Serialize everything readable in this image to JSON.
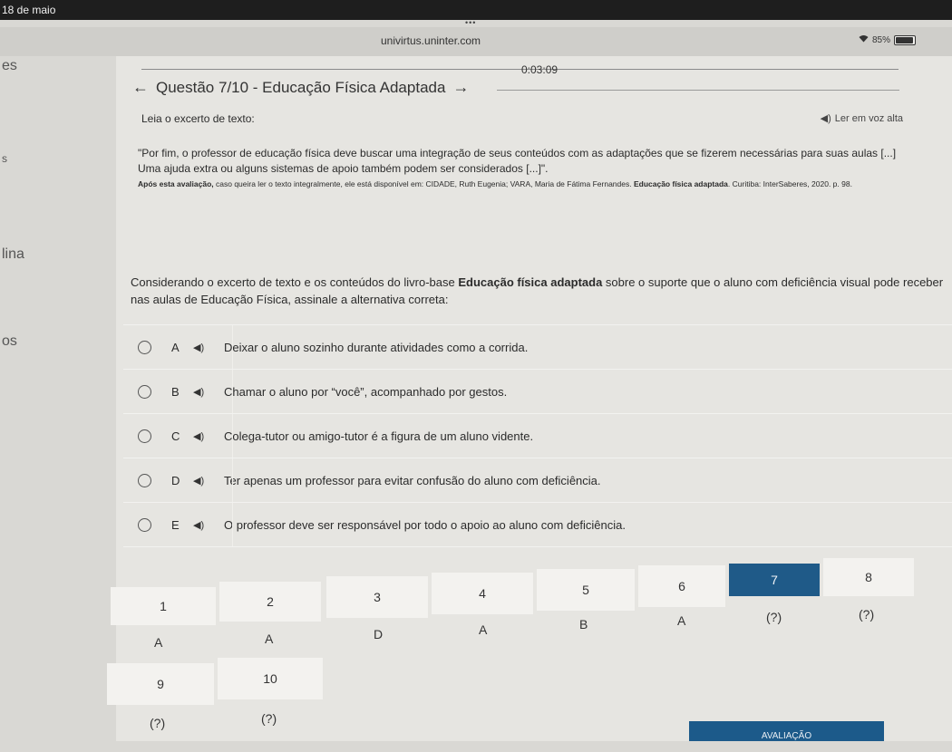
{
  "status": {
    "date": "18 de maio",
    "battery": "85%"
  },
  "browser": {
    "url": "univirtus.uninter.com"
  },
  "sidebar_fragments": [
    "es",
    "s",
    "lina",
    "os"
  ],
  "quiz": {
    "timer": "0:03:09",
    "title": "Questão 7/10 - Educação Física Adaptada",
    "lead": "Leia o excerto de texto:",
    "tts_label": "Ler em voz alta",
    "quote": "\"Por fim, o professor de educação física deve buscar uma integração de seus conteúdos com as adaptações que se fizerem necessárias para suas aulas [...] Uma ajuda extra ou alguns sistemas de apoio também podem ser considerados [...]\".",
    "citation_pre": "Após esta avaliação,",
    "citation_mid": " caso queira ler o texto integralmente, ele está disponível em: CIDADE, Ruth Eugenia; VARA, Maria de Fátima Fernandes. ",
    "citation_book": "Educação física adaptada",
    "citation_post": ". Curitiba: InterSaberes, 2020. p. 98.",
    "stem_pre": "Considerando o excerto de texto e os conteúdos do livro-base ",
    "stem_book": "Educação física adaptada",
    "stem_post": " sobre o suporte que o aluno com deficiência visual pode receber nas aulas de Educação Física, assinale a alternativa correta:",
    "options": [
      {
        "letter": "A",
        "text": "Deixar o aluno sozinho durante atividades como a corrida."
      },
      {
        "letter": "B",
        "text": "Chamar o aluno por “você”, acompanhado por gestos."
      },
      {
        "letter": "C",
        "text": "Colega-tutor ou amigo-tutor é a figura de um aluno vidente."
      },
      {
        "letter": "D",
        "text": "Ter apenas um professor para evitar confusão do aluno com deficiência."
      },
      {
        "letter": "E",
        "text": "O professor deve ser responsável por todo o apoio ao aluno com deficiência."
      }
    ]
  },
  "answer_grid": {
    "numbers": [
      "1",
      "2",
      "3",
      "4",
      "5",
      "6",
      "7",
      "8",
      "9",
      "10"
    ],
    "answers": [
      "A",
      "A",
      "D",
      "A",
      "B",
      "A",
      "(?)",
      "(?)",
      "(?)",
      "(?)"
    ]
  },
  "footer_button": "AVALIAÇÃO"
}
